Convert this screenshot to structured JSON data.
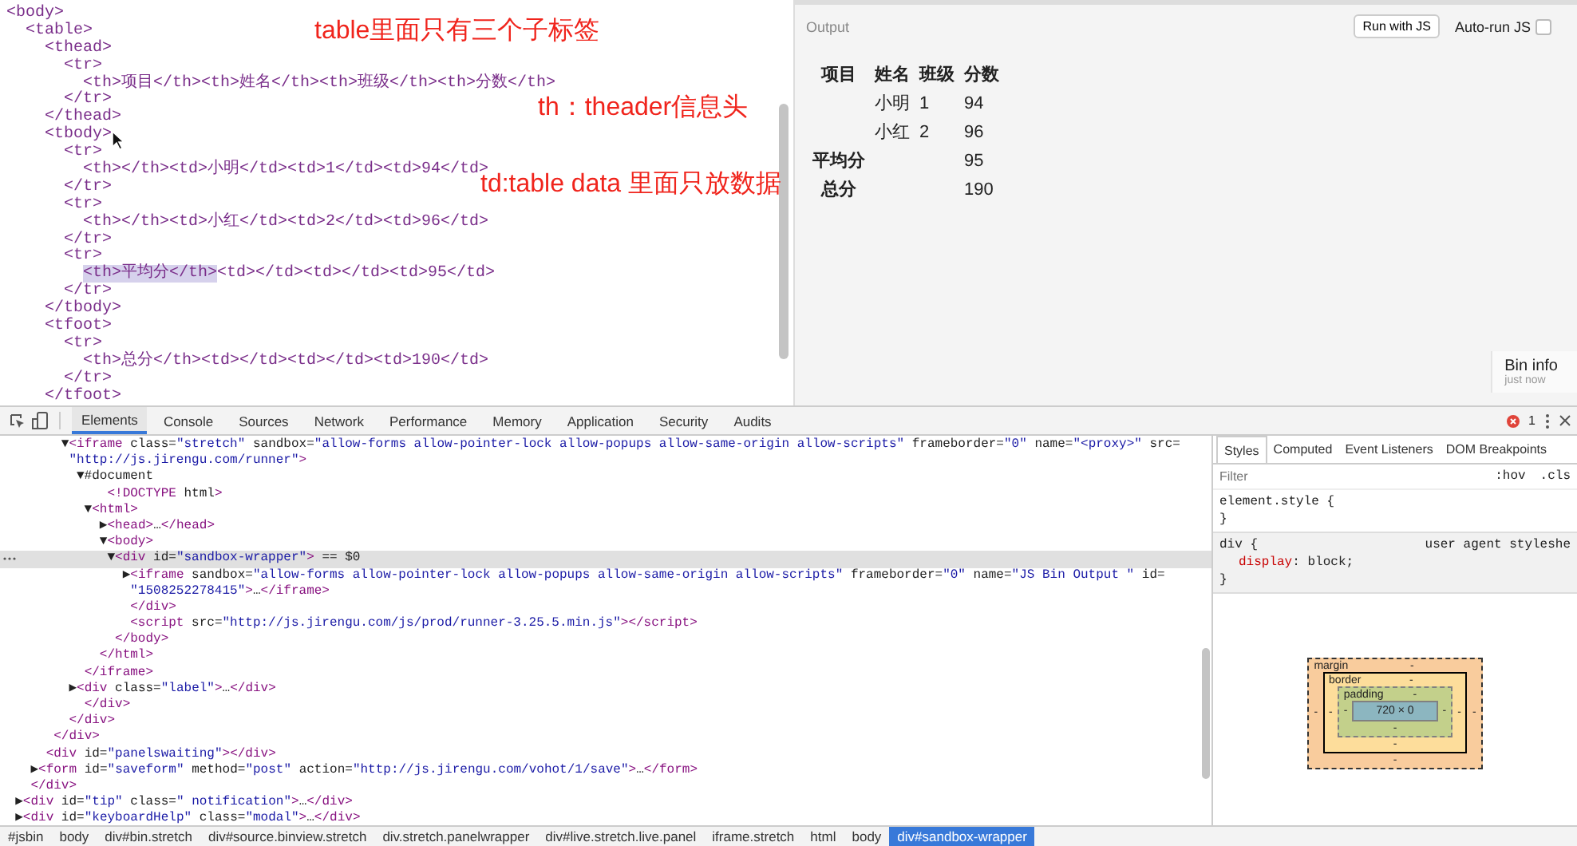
{
  "editor": {
    "lines": [
      {
        "parts": [
          {
            "text": "<body>",
            "selected": false
          }
        ]
      },
      {
        "parts": [
          {
            "text": "  <table>",
            "selected": false
          }
        ]
      },
      {
        "parts": [
          {
            "text": "    <thead>",
            "selected": false
          }
        ]
      },
      {
        "parts": [
          {
            "text": "      <tr>",
            "selected": false
          }
        ]
      },
      {
        "parts": [
          {
            "text": "        <th>项目</th><th>姓名</th><th>班级</th><th>分数</th>",
            "selected": false
          }
        ]
      },
      {
        "parts": [
          {
            "text": "      </tr>",
            "selected": false
          }
        ]
      },
      {
        "parts": [
          {
            "text": "    </thead>",
            "selected": false
          }
        ]
      },
      {
        "parts": [
          {
            "text": "    <tbody>",
            "selected": false
          }
        ]
      },
      {
        "parts": [
          {
            "text": "      <tr>",
            "selected": false
          }
        ]
      },
      {
        "parts": [
          {
            "text": "        <th></th><td>小明</td><td>1</td><td>94</td>",
            "selected": false
          }
        ]
      },
      {
        "parts": [
          {
            "text": "      </tr>",
            "selected": false
          }
        ]
      },
      {
        "parts": [
          {
            "text": "      <tr>",
            "selected": false
          }
        ]
      },
      {
        "parts": [
          {
            "text": "        <th></th><td>小红</td><td>2</td><td>96</td>",
            "selected": false
          }
        ]
      },
      {
        "parts": [
          {
            "text": "      </tr>",
            "selected": false
          }
        ]
      },
      {
        "parts": [
          {
            "text": "      <tr>",
            "selected": false
          }
        ]
      },
      {
        "parts": [
          {
            "text": "        <th>平均分</th>",
            "selected": true
          },
          {
            "text": "<td></td><td></td><td>95</td>",
            "selected": false
          }
        ]
      },
      {
        "parts": [
          {
            "text": "      </tr>",
            "selected": false
          }
        ]
      },
      {
        "parts": [
          {
            "text": "    </tbody>",
            "selected": false
          }
        ]
      },
      {
        "parts": [
          {
            "text": "    <tfoot>",
            "selected": false
          }
        ]
      },
      {
        "parts": [
          {
            "text": "      <tr>",
            "selected": false
          }
        ]
      },
      {
        "parts": [
          {
            "text": "        <th>总分</th><td></td><td></td><td>190</td>",
            "selected": false
          }
        ]
      },
      {
        "parts": [
          {
            "text": "      </tr>",
            "selected": false
          }
        ]
      },
      {
        "parts": [
          {
            "text": "    </tfoot>",
            "selected": false
          }
        ]
      }
    ],
    "annotations": [
      {
        "text": "table里面只有三个子标签"
      },
      {
        "text": "th：theader信息头"
      },
      {
        "text": "td:table data 里面只放数据"
      }
    ]
  },
  "output": {
    "title": "Output",
    "run_button": "Run with JS",
    "auto_run": {
      "label": "Auto-run JS",
      "checked": false
    },
    "table": {
      "columns": [
        "项目",
        "姓名",
        "班级",
        "分数"
      ],
      "rows": [
        {
          "cells": [
            null,
            "小明",
            "1",
            "94"
          ]
        },
        {
          "cells": [
            null,
            "小红",
            "2",
            "96"
          ]
        },
        {
          "cells": [
            "平均分",
            null,
            null,
            "95"
          ]
        },
        {
          "cells": [
            "总分",
            null,
            null,
            "190"
          ]
        }
      ]
    },
    "bin_info": {
      "title": "Bin info",
      "time": "just now"
    }
  },
  "devtools": {
    "tabs": [
      {
        "label": "Elements",
        "selected": true
      },
      {
        "label": "Console",
        "selected": false
      },
      {
        "label": "Sources",
        "selected": false
      },
      {
        "label": "Network",
        "selected": false
      },
      {
        "label": "Performance",
        "selected": false
      },
      {
        "label": "Memory",
        "selected": false
      },
      {
        "label": "Application",
        "selected": false
      },
      {
        "label": "Security",
        "selected": false
      },
      {
        "label": "Audits",
        "selected": false
      }
    ],
    "error_count": "1",
    "dom_lines": [
      {
        "text": "        ▼<iframe class=\"stretch\" sandbox=\"allow-forms allow-pointer-lock allow-popups allow-same-origin allow-scripts\" frameborder=\"0\" name=\"<proxy>\" src=",
        "selected": false
      },
      {
        "text": "         \"http://js.jirengu.com/runner\">",
        "selected": false
      },
      {
        "text": "          ▼#document",
        "selected": false
      },
      {
        "text": "              <!DOCTYPE html>",
        "selected": false
      },
      {
        "text": "           ▼<html>",
        "selected": false
      },
      {
        "text": "             ▶<head>…</head>",
        "selected": false
      },
      {
        "text": "             ▼<body>",
        "selected": false
      },
      {
        "text": "              ▼<div id=\"sandbox-wrapper\"> == $0",
        "selected": true
      },
      {
        "text": "                ▶<iframe sandbox=\"allow-forms allow-pointer-lock allow-popups allow-same-origin allow-scripts\" frameborder=\"0\" name=\"JS Bin Output \" id=",
        "selected": false
      },
      {
        "text": "                 \"1508252278415\">…</iframe>",
        "selected": false
      },
      {
        "text": "                 </div>",
        "selected": false
      },
      {
        "text": "                 <script src=\"http://js.jirengu.com/js/prod/runner-3.25.5.min.js\"></script>",
        "selected": false
      },
      {
        "text": "               </body>",
        "selected": false
      },
      {
        "text": "             </html>",
        "selected": false
      },
      {
        "text": "           </iframe>",
        "selected": false
      },
      {
        "text": "         ▶<div class=\"label\">…</div>",
        "selected": false
      },
      {
        "text": "           </div>",
        "selected": false
      },
      {
        "text": "         </div>",
        "selected": false
      },
      {
        "text": "       </div>",
        "selected": false
      },
      {
        "text": "      <div id=\"panelswaiting\"></div>",
        "selected": false
      },
      {
        "text": "    ▶<form id=\"saveform\" method=\"post\" action=\"http://js.jirengu.com/vohot/1/save\">…</form>",
        "selected": false
      },
      {
        "text": "    </div>",
        "selected": false
      },
      {
        "text": "  ▶<div id=\"tip\" class=\" notification\">…</div>",
        "selected": false
      },
      {
        "text": "  ▶<div id=\"keyboardHelp\" class=\"modal\">…</div>",
        "selected": false
      }
    ],
    "styles": {
      "tabs": [
        {
          "label": "Styles",
          "selected": true
        },
        {
          "label": "Computed",
          "selected": false
        },
        {
          "label": "Event Listeners",
          "selected": false
        },
        {
          "label": "DOM Breakpoints",
          "selected": false
        }
      ],
      "filter_placeholder": "Filter",
      "hov": ":hov",
      "cls": ".cls",
      "rules": [
        {
          "selector": "element.style {",
          "close": "}"
        },
        {
          "selector": "div {",
          "source": "user agent styleshe",
          "declarations": [
            {
              "property": "display",
              "separator": ":",
              "value": "block;"
            }
          ],
          "close": "}"
        }
      ],
      "box_model": {
        "margin": {
          "label": "margin",
          "top": "-",
          "right": "-",
          "bottom": "-",
          "left": "-"
        },
        "border": {
          "label": "border",
          "top": "-",
          "right": "-",
          "bottom": "-",
          "left": "-"
        },
        "padding": {
          "label": "padding",
          "top": "-",
          "right": "-",
          "bottom": "-",
          "left": "-"
        },
        "content": "720 × 0"
      }
    },
    "breadcrumbs": [
      {
        "label": "#jsbin",
        "selected": false
      },
      {
        "label": "body",
        "selected": false
      },
      {
        "label": "div#bin.stretch",
        "selected": false
      },
      {
        "label": "div#source.binview.stretch",
        "selected": false
      },
      {
        "label": "div.stretch.panelwrapper",
        "selected": false
      },
      {
        "label": "div#live.stretch.live.panel",
        "selected": false
      },
      {
        "label": "iframe.stretch",
        "selected": false
      },
      {
        "label": "html",
        "selected": false
      },
      {
        "label": "body",
        "selected": false
      },
      {
        "label": "div#sandbox-wrapper",
        "selected": true
      }
    ]
  }
}
